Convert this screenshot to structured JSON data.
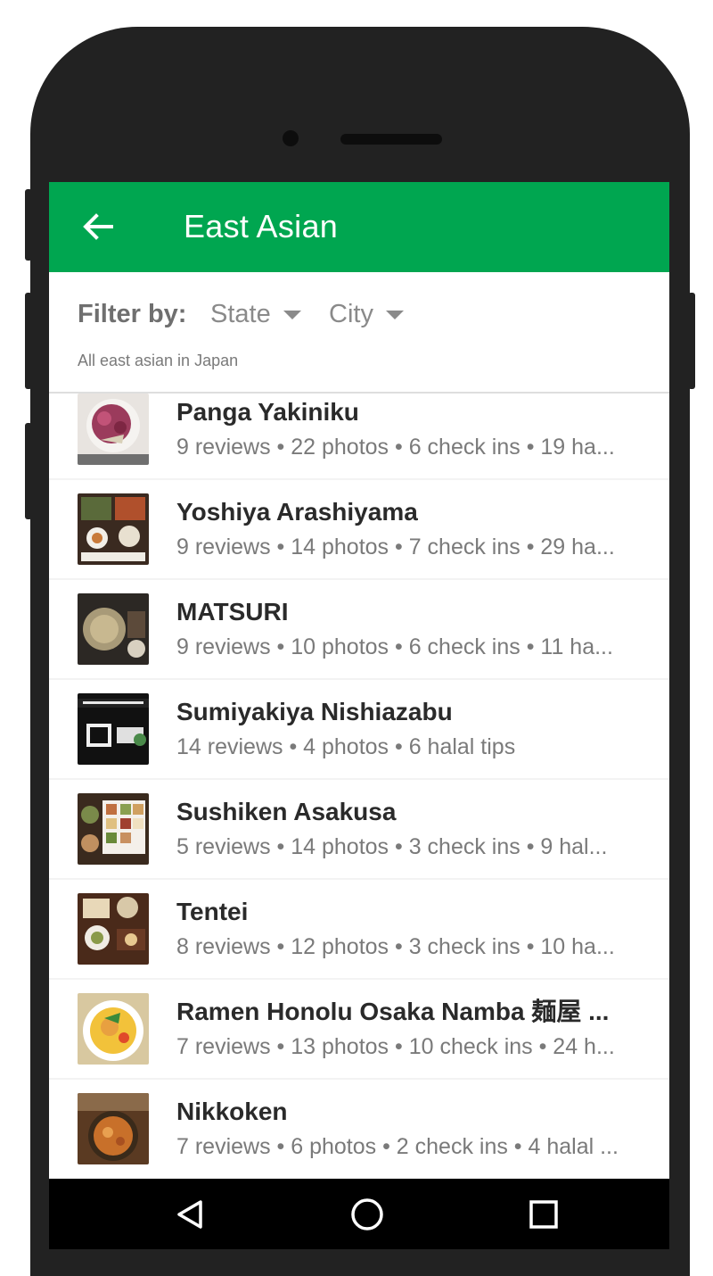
{
  "appbar": {
    "title": "East Asian",
    "back_icon": "arrow-left-icon"
  },
  "filter": {
    "label": "Filter by:",
    "state_label": "State",
    "city_label": "City",
    "subtitle": "All east asian in Japan"
  },
  "restaurants": [
    {
      "name": "Panga Yakiniku",
      "meta": "9 reviews • 22 photos • 6 check ins • 19 ha..."
    },
    {
      "name": "Yoshiya Arashiyama",
      "meta": "9 reviews • 14 photos • 7 check ins • 29 ha..."
    },
    {
      "name": "MATSURI",
      "meta": "9 reviews • 10 photos • 6 check ins • 11 ha..."
    },
    {
      "name": "Sumiyakiya Nishiazabu",
      "meta": "14 reviews • 4 photos • 6 halal tips"
    },
    {
      "name": "Sushiken Asakusa",
      "meta": "5 reviews • 14 photos • 3 check ins • 9 hal..."
    },
    {
      "name": "Tentei",
      "meta": "8 reviews • 12 photos • 3 check ins • 10 ha..."
    },
    {
      "name": "Ramen Honolu Osaka Namba 麺屋 ...",
      "meta": "7 reviews • 13 photos • 10 check ins • 24 h..."
    },
    {
      "name": "Nikkoken",
      "meta": "7 reviews • 6 photos • 2 check ins • 4 halal ..."
    }
  ],
  "navbar": {
    "back_icon": "triangle-back-icon",
    "home_icon": "circle-home-icon",
    "recents_icon": "square-recents-icon"
  },
  "colors": {
    "appbar": "#00a650",
    "phone_body": "#222222",
    "navbar": "#000000"
  }
}
